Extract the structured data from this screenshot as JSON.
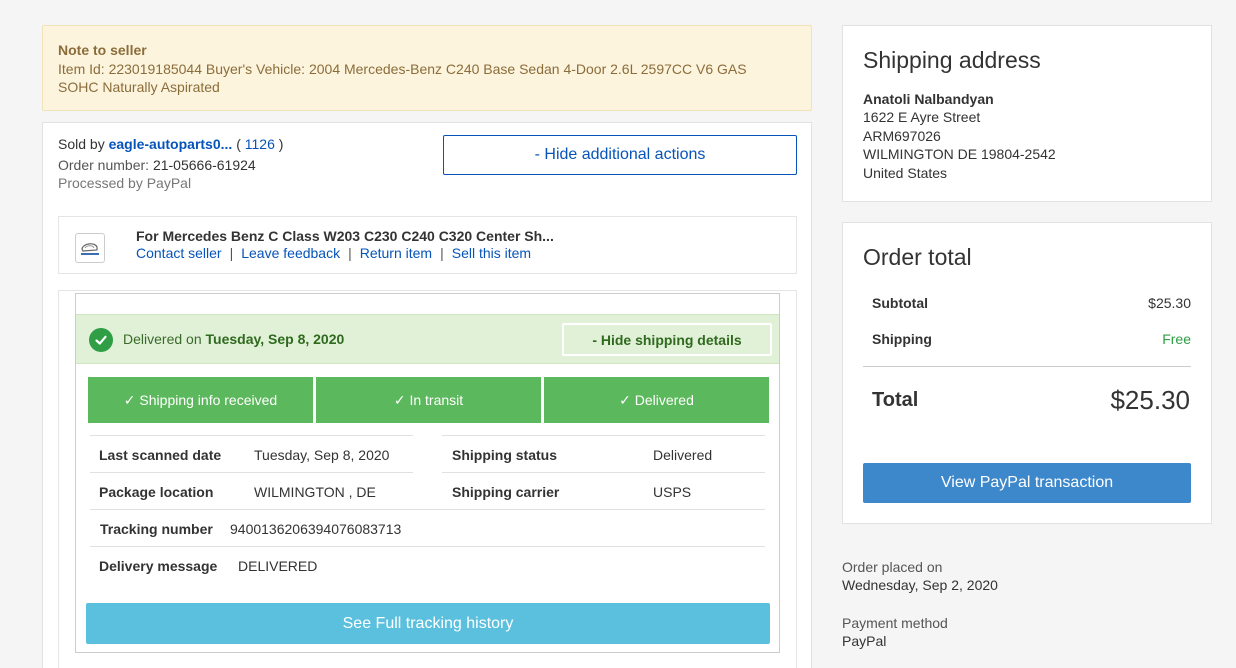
{
  "note": {
    "title": "Note to seller",
    "line1": "Item Id: 223019185044 Buyer's Vehicle: 2004 Mercedes-Benz C240 Base Sedan 4-Door 2.6L 2597CC V6 GAS",
    "line2": "SOHC Naturally Aspirated"
  },
  "order": {
    "sold_by_label": "Sold by",
    "seller": "eagle-autoparts0...",
    "feedback_open": "(",
    "feedback_count": "1126",
    "feedback_close": ")",
    "order_number_label": "Order number:",
    "order_number": "21-05666-61924",
    "processed": "Processed by PayPal",
    "hide_actions_label": "- Hide additional actions"
  },
  "item": {
    "title": "For Mercedes Benz C Class W203 C230 C240 C320 Center Sh...",
    "links": [
      "Contact seller",
      "Leave feedback",
      "Return item",
      "Sell this item"
    ],
    "separator": "|"
  },
  "shipping": {
    "delivered_prefix": "Delivered on",
    "delivered_date": "Tuesday, Sep 8, 2020",
    "hide_details_label": "- Hide shipping details",
    "steps": [
      "✓ Shipping info received",
      "✓ In transit",
      "✓ Delivered"
    ],
    "details": {
      "last_scanned_label": "Last scanned date",
      "last_scanned": "Tuesday, Sep 8, 2020",
      "shipping_status_label": "Shipping status",
      "shipping_status": "Delivered",
      "package_location_label": "Package location",
      "package_location": "WILMINGTON , DE",
      "shipping_carrier_label": "Shipping carrier",
      "shipping_carrier": "USPS",
      "tracking_number_label": "Tracking number",
      "tracking_number": "9400136206394076083713",
      "delivery_message_label": "Delivery message",
      "delivery_message": "DELIVERED"
    },
    "full_tracking_label": "See Full tracking history"
  },
  "address": {
    "title": "Shipping address",
    "name": "Anatoli Nalbandyan",
    "street": "1622 E Ayre Street",
    "line2": "ARM697026",
    "city": "WILMINGTON DE 19804-2542",
    "country": "United States"
  },
  "total": {
    "title": "Order total",
    "subtotal_label": "Subtotal",
    "subtotal": "$25.30",
    "shipping_label": "Shipping",
    "shipping": "Free",
    "total_label": "Total",
    "total": "$25.30",
    "paypal_button": "View PayPal transaction"
  },
  "meta": {
    "placed_label": "Order placed on",
    "placed_date": "Wednesday, Sep 2, 2020",
    "payment_label": "Payment method",
    "payment_method": "PayPal"
  },
  "colors": {
    "link": "#0654ba",
    "success_green": "#5cb85c",
    "delivered_bg": "#e1f1d8",
    "tracking_button": "#5bc0de",
    "paypal_button": "#3d87cb",
    "note_bg": "#fdf4dd"
  }
}
